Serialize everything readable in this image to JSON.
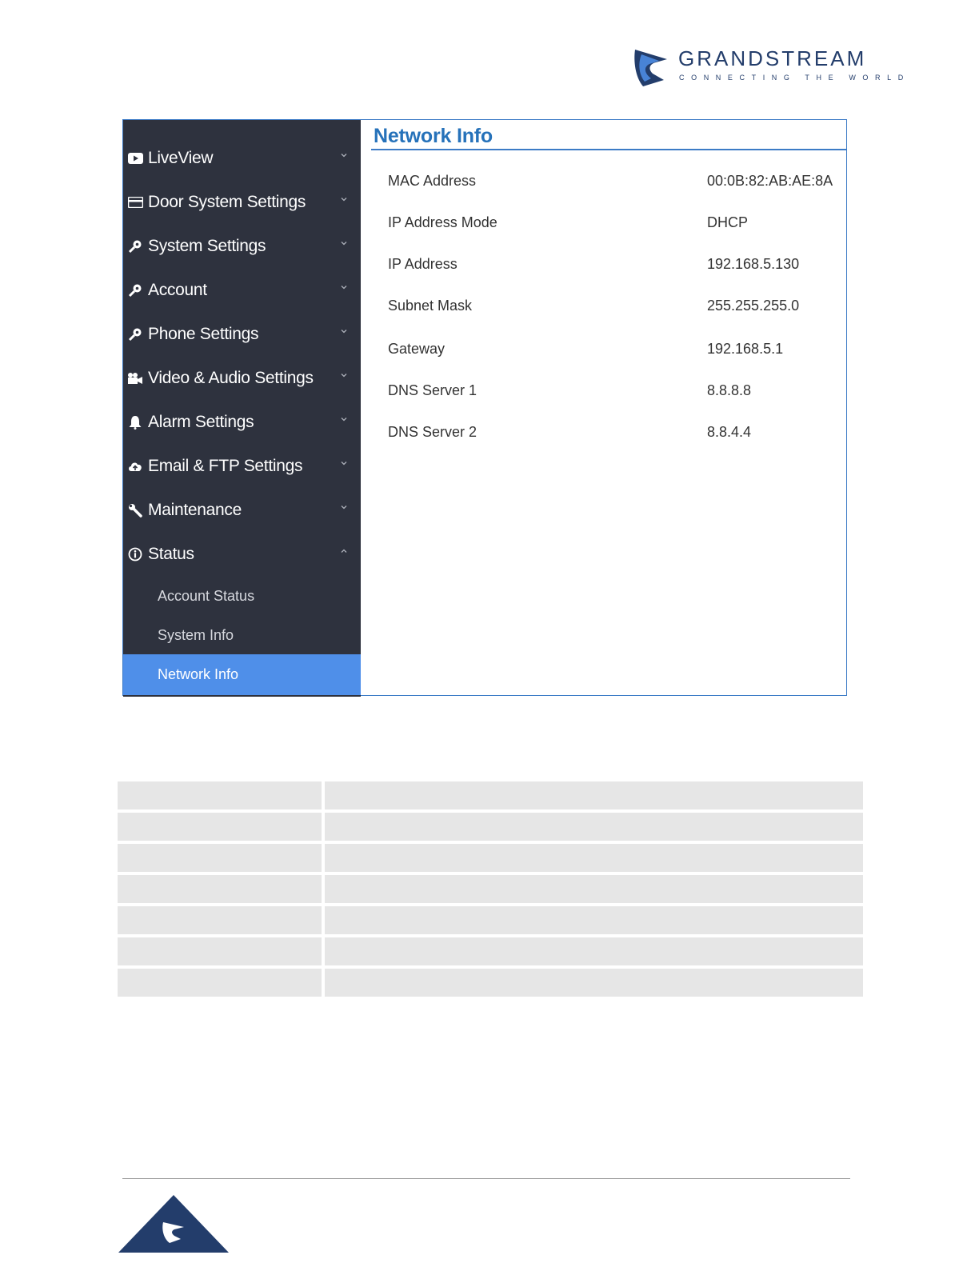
{
  "header": {
    "brand_name": "GRANDSTREAM",
    "brand_tagline": "CONNECTING THE WORLD",
    "brand_color": "#233d6b"
  },
  "sidebar": {
    "bg_color": "#2e323e",
    "active_color": "#4f8fe9",
    "items": [
      {
        "label": "LiveView",
        "icon": "play-icon"
      },
      {
        "label": "Door System Settings",
        "icon": "card-icon"
      },
      {
        "label": "System Settings",
        "icon": "key-icon"
      },
      {
        "label": "Account",
        "icon": "key-icon"
      },
      {
        "label": "Phone Settings",
        "icon": "key-icon"
      },
      {
        "label": "Video & Audio Settings",
        "icon": "camera-icon"
      },
      {
        "label": "Alarm Settings",
        "icon": "bell-icon"
      },
      {
        "label": "Email & FTP Settings",
        "icon": "cloud-upload-icon"
      },
      {
        "label": "Maintenance",
        "icon": "wrench-icon"
      },
      {
        "label": "Status",
        "icon": "info-icon",
        "expanded": true
      }
    ],
    "sub_items": [
      {
        "label": "Account Status"
      },
      {
        "label": "System Info"
      },
      {
        "label": "Network Info",
        "active": true
      }
    ]
  },
  "panel": {
    "title": "Network Info",
    "title_color": "#2672ba",
    "rows": [
      {
        "label": "MAC Address",
        "value": "00:0B:82:AB:AE:8A"
      },
      {
        "label": "IP Address Mode",
        "value": "DHCP"
      },
      {
        "label": "IP Address",
        "value": "192.168.5.130"
      },
      {
        "label": "Subnet Mask",
        "value": "255.255.255.0"
      },
      {
        "label": "Gateway",
        "value": "192.168.5.1"
      },
      {
        "label": "DNS Server 1",
        "value": "8.8.8.8"
      },
      {
        "label": "DNS Server 2",
        "value": "8.8.4.4"
      }
    ]
  }
}
